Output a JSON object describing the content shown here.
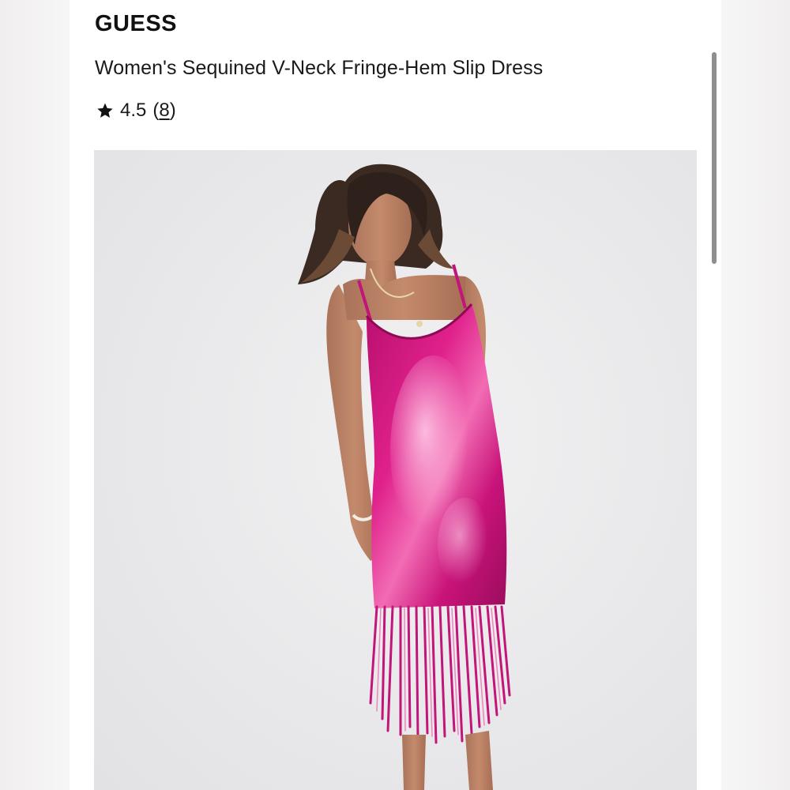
{
  "brand": "GUESS",
  "product": {
    "title": "Women's Sequined V-Neck Fringe-Hem Slip Dress",
    "rating": "4.5",
    "review_count": "8"
  },
  "icons": {
    "rating_icon": "star-icon"
  },
  "colors": {
    "dress": "#d1177f",
    "text": "#111111",
    "page_bg": "#ffffff",
    "photo_bg": "#e8e8ea"
  }
}
